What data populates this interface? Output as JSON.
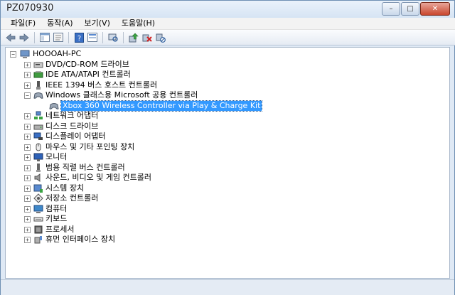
{
  "window": {
    "title": "PZ070930",
    "minimize_glyph": "–",
    "maximize_glyph": "□",
    "close_glyph": "✕"
  },
  "menu": [
    "파일(F)",
    "동작(A)",
    "보기(V)",
    "도움말(H)"
  ],
  "toolbar": {
    "icons": [
      "back-arrow-icon",
      "forward-arrow-icon",
      "show-tree-icon",
      "properties-icon",
      "help-icon",
      "view-icon",
      "scan-hardware-icon",
      "update-driver-icon",
      "uninstall-icon",
      "disable-icon"
    ]
  },
  "tree": {
    "root": "HOOOAH-PC",
    "items": [
      {
        "label": "DVD/CD-ROM 드라이브",
        "icon": "dvd-drive-icon",
        "expander": "+"
      },
      {
        "label": "IDE ATA/ATAPI 컨트롤러",
        "icon": "ide-controller-icon",
        "expander": "+"
      },
      {
        "label": "IEEE 1394 버스 호스트 컨트롤러",
        "icon": "ieee1394-icon",
        "expander": "+"
      },
      {
        "label": "Windows 클래스용 Microsoft 공용 컨트롤러",
        "icon": "game-controller-icon",
        "expander": "−"
      },
      {
        "label": "Xbox 360 Wireless Controller via Play & Charge Kit",
        "icon": "game-controller-icon",
        "child": true,
        "selected": true
      },
      {
        "label": "네트워크 어댑터",
        "icon": "network-adapter-icon",
        "expander": "+"
      },
      {
        "label": "디스크 드라이브",
        "icon": "disk-drive-icon",
        "expander": "+"
      },
      {
        "label": "디스플레이 어댑터",
        "icon": "display-adapter-icon",
        "expander": "+"
      },
      {
        "label": "마우스 및 기타 포인팅 장치",
        "icon": "mouse-icon",
        "expander": "+"
      },
      {
        "label": "모니터",
        "icon": "monitor-icon",
        "expander": "+"
      },
      {
        "label": "범용 직렬 버스 컨트롤러",
        "icon": "usb-icon",
        "expander": "+"
      },
      {
        "label": "사운드, 비디오 및 게임 컨트롤러",
        "icon": "speaker-icon",
        "expander": "+"
      },
      {
        "label": "시스템 장치",
        "icon": "system-device-icon",
        "expander": "+"
      },
      {
        "label": "저장소 컨트롤러",
        "icon": "storage-controller-icon",
        "expander": "+"
      },
      {
        "label": "컴퓨터",
        "icon": "computer-icon",
        "expander": "+"
      },
      {
        "label": "키보드",
        "icon": "keyboard-icon",
        "expander": "+"
      },
      {
        "label": "프로세서",
        "icon": "processor-icon",
        "expander": "+"
      },
      {
        "label": "휴먼 인터페이스 장치",
        "icon": "hid-icon",
        "expander": "+"
      }
    ]
  },
  "colors": {
    "selection": "#3399ff",
    "title_bg": "#dfe9f5"
  }
}
